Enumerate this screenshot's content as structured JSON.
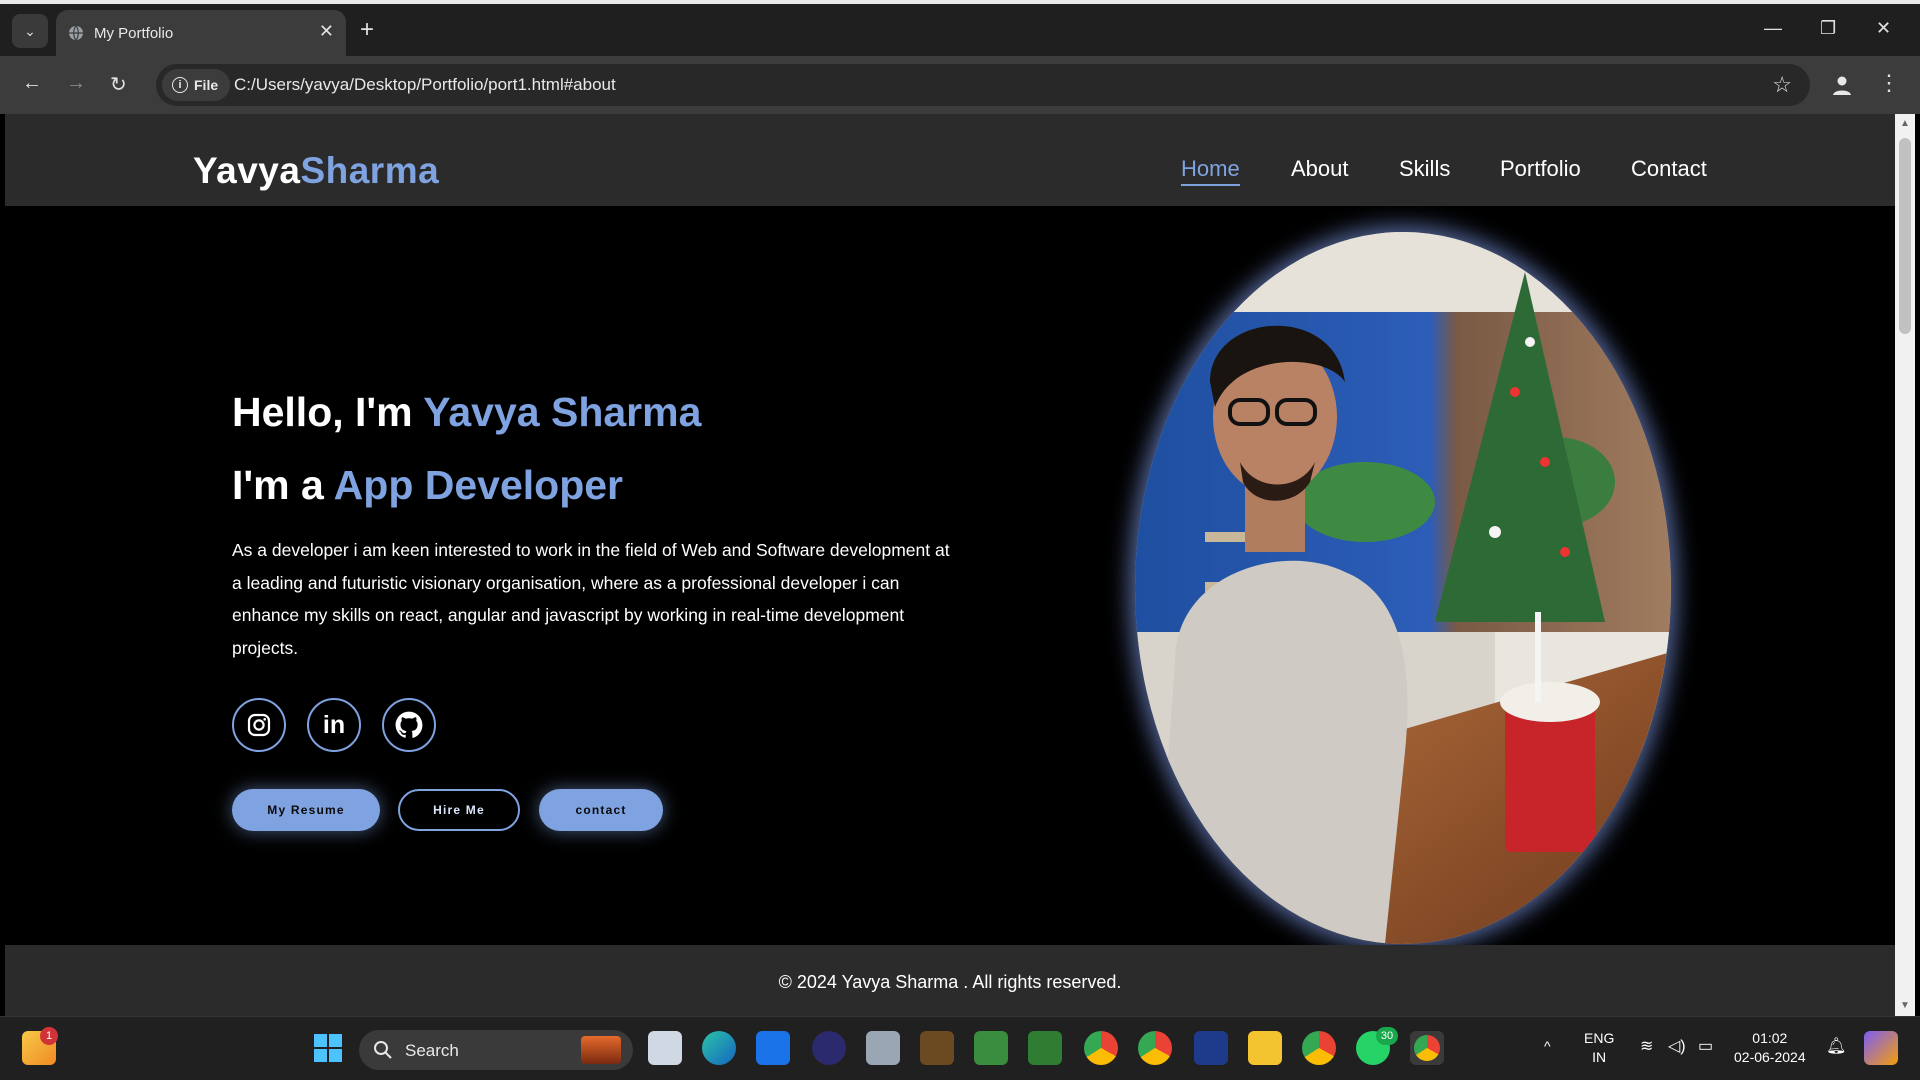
{
  "browser": {
    "tab_title": "My Portfolio",
    "file_label": "File",
    "url": "C:/Users/yavya/Desktop/Portfolio/port1.html#about"
  },
  "site": {
    "logo_first": "Yavya",
    "logo_second": "Sharma",
    "nav": [
      "Home",
      "About",
      "Skills",
      "Portfolio",
      "Contact"
    ],
    "active_nav": "Home",
    "hero": {
      "hello_prefix": "Hello, I'm ",
      "hello_name": "Yavya Sharma",
      "role_prefix": "I'm a ",
      "role": "App Developer",
      "description": "As a developer i am keen interested to work in the field of Web and Software development at a leading and futuristic visionary organisation, where as a professional developer i can enhance my skills on react, angular and javascript by working in real-time development projects."
    },
    "social_icons": [
      "instagram-icon",
      "linkedin-icon",
      "github-icon"
    ],
    "buttons": {
      "resume": "My Resume",
      "hire": "Hire Me",
      "contact": "contact"
    },
    "footer": "© 2024 Yavya Sharma . All rights reserved.",
    "accent_color": "#7fa2e0"
  },
  "taskbar": {
    "search_label": "Search",
    "notification_count": "1",
    "whatsapp_count": "30",
    "language": "ENG",
    "region": "IN",
    "time": "01:02",
    "date": "02-06-2024"
  }
}
